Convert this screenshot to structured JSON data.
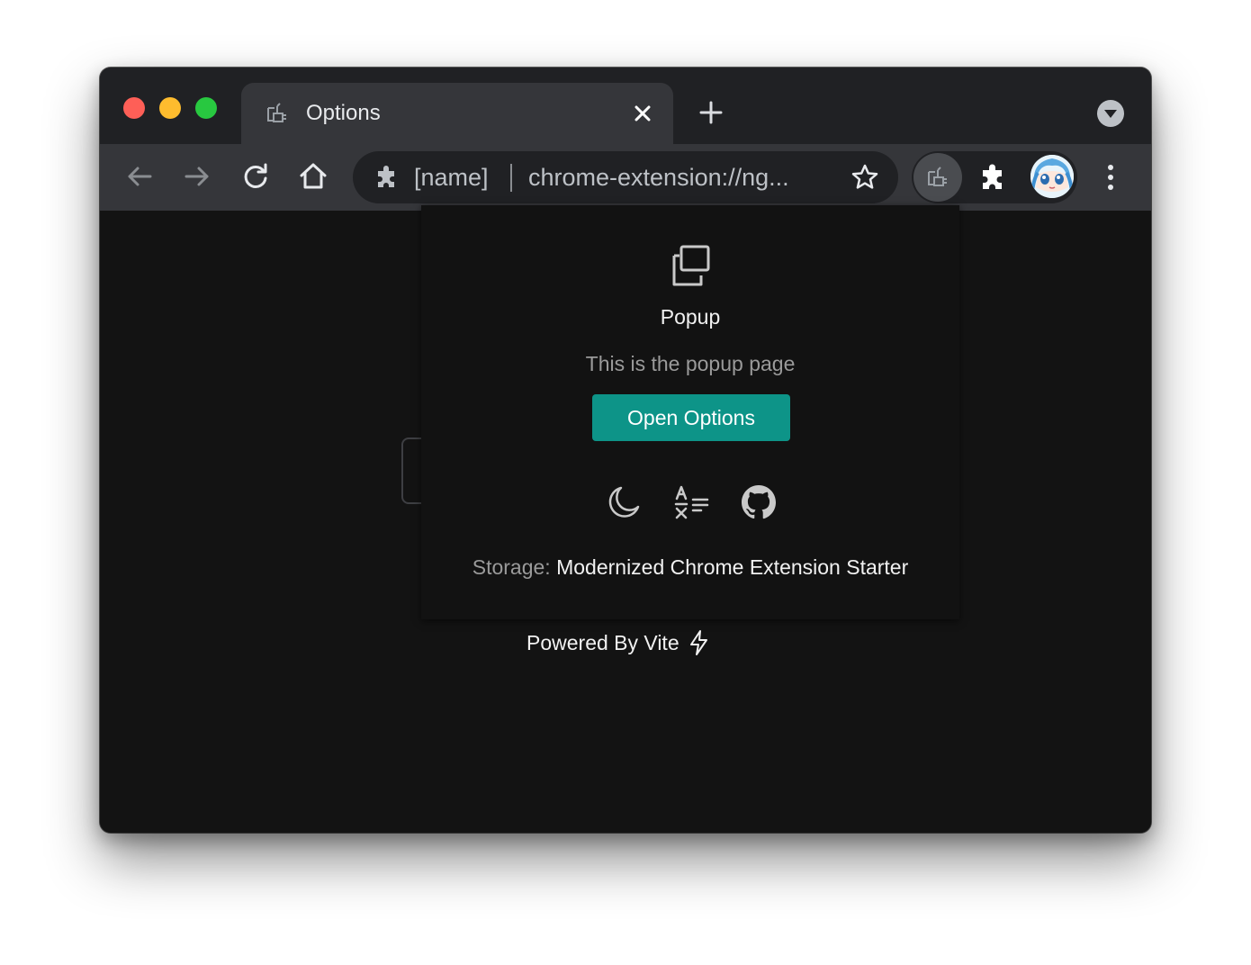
{
  "tab": {
    "title": "Options",
    "favicon": "extension-favicon-icon"
  },
  "omnibox": {
    "site_name": "[name]",
    "url": "chrome-extension://ng..."
  },
  "popup": {
    "title": "Popup",
    "description": "This is the popup page",
    "button_label": "Open Options",
    "storage_label": "Storage:",
    "storage_value": "Modernized Chrome Extension Starter",
    "icons": [
      "moon-icon",
      "translate-icon",
      "github-icon"
    ]
  },
  "footer": {
    "powered_by": "Powered By Vite",
    "icon": "lightning-icon"
  },
  "colors": {
    "accent": "#0d9488",
    "titlebar": "#202124",
    "toolbar": "#35363a",
    "content": "#131313"
  }
}
